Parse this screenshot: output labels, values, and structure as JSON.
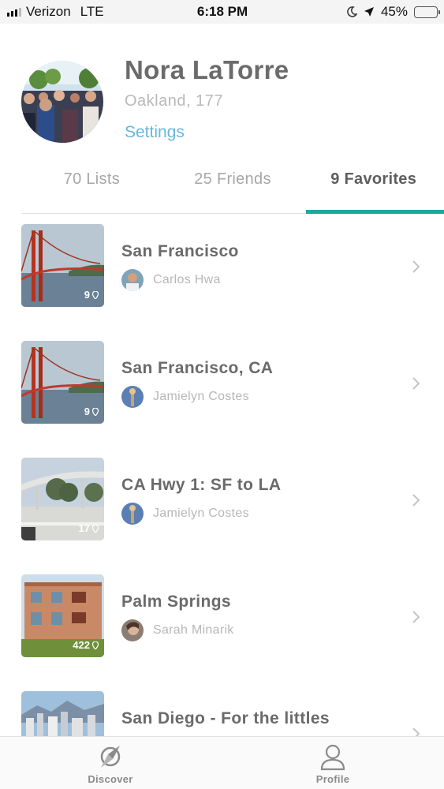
{
  "status_bar": {
    "carrier": "Verizon",
    "network": "LTE",
    "time": "6:18 PM",
    "battery": "45%",
    "battery_level": 0.45
  },
  "profile": {
    "name": "Nora LaTorre",
    "location": "Oakland, 177",
    "settings_label": "Settings"
  },
  "tabs": [
    {
      "label": "70 Lists",
      "active": false
    },
    {
      "label": "25 Friends",
      "active": false
    },
    {
      "label": "9 Favorites",
      "active": true
    }
  ],
  "favorites": [
    {
      "title": "San Francisco",
      "owner": "Carlos Hwa",
      "pins": "9",
      "thumb": "golden-gate-bridge"
    },
    {
      "title": "San Francisco, CA",
      "owner": "Jamielyn Costes",
      "pins": "9",
      "thumb": "golden-gate-bridge"
    },
    {
      "title": "CA Hwy 1: SF to LA",
      "owner": "Jamielyn Costes",
      "pins": "17",
      "thumb": "coastal-highway"
    },
    {
      "title": "Palm Springs",
      "owner": "Sarah Minarik",
      "pins": "422",
      "thumb": "building"
    },
    {
      "title": "San Diego - For the littles",
      "owner": "",
      "pins": "",
      "thumb": "city-skyline"
    }
  ],
  "bottom_nav": {
    "discover_label": "Discover",
    "profile_label": "Profile"
  },
  "colors": {
    "accent": "#1aaa9b",
    "link": "#68b7db",
    "battery_fill": "#f2c200"
  }
}
